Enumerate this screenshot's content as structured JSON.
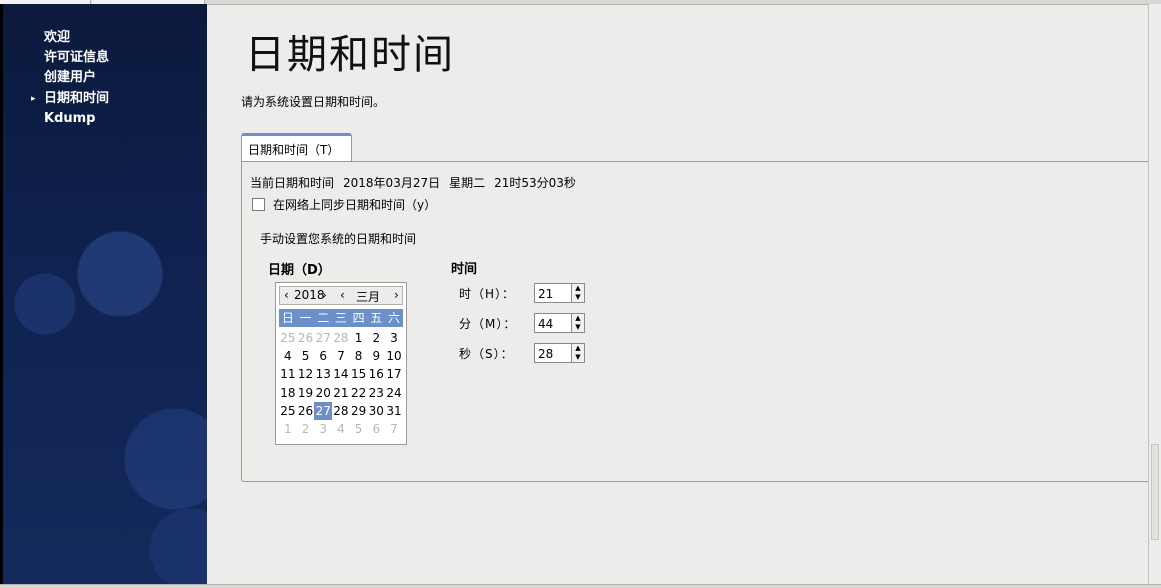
{
  "sidebar": {
    "items": [
      {
        "label": "欢迎",
        "current": false
      },
      {
        "label": "许可证信息",
        "current": false
      },
      {
        "label": "创建用户",
        "current": false
      },
      {
        "label": "日期和时间",
        "current": true
      },
      {
        "label": "Kdump",
        "current": false
      }
    ],
    "current_marker": "▸"
  },
  "page": {
    "title": "日期和时间",
    "description": "请为系统设置日期和时间。"
  },
  "tab": {
    "label": "日期和时间（T）"
  },
  "current_datetime": {
    "label": "当前日期和时间",
    "date": "2018年03月27日",
    "weekday": "星期二",
    "time": "21时53分03秒"
  },
  "sync": {
    "label": "在网络上同步日期和时间（y）",
    "checked": false
  },
  "manual": {
    "label": "手动设置您系统的日期和时间"
  },
  "date_section": {
    "heading": "日期（D）"
  },
  "time_section": {
    "heading": "时间"
  },
  "calendar": {
    "year": "2018",
    "month": "三月",
    "prev": "‹",
    "next": "›",
    "weekdays": [
      "日",
      "一",
      "二",
      "三",
      "四",
      "五",
      "六"
    ],
    "rows": [
      [
        "25",
        "26",
        "27",
        "28",
        "1",
        "2",
        "3"
      ],
      [
        "4",
        "5",
        "6",
        "7",
        "8",
        "9",
        "10"
      ],
      [
        "11",
        "12",
        "13",
        "14",
        "15",
        "16",
        "17"
      ],
      [
        "18",
        "19",
        "20",
        "21",
        "22",
        "23",
        "24"
      ],
      [
        "25",
        "26",
        "27",
        "28",
        "29",
        "30",
        "31"
      ],
      [
        "1",
        "2",
        "3",
        "4",
        "5",
        "6",
        "7"
      ]
    ],
    "selected": "27",
    "colors": {
      "header_bg": "#6c8fc7",
      "selected_bg": "#6c8fc7",
      "other_month": "#b8b7b4"
    }
  },
  "time": {
    "hour": {
      "label": "时（H）：",
      "value": "21"
    },
    "minute": {
      "label": "分（M）：",
      "value": "44"
    },
    "second": {
      "label": "秒（S）：",
      "value": "28"
    },
    "spin_up": "▲",
    "spin_down": "▼"
  }
}
